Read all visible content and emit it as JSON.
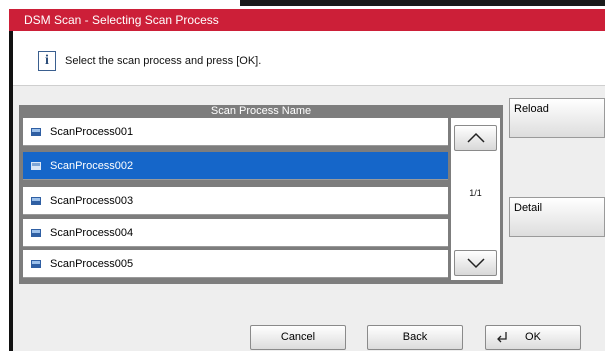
{
  "window": {
    "title": "DSM Scan - Selecting Scan Process"
  },
  "message": {
    "icon": "info-icon",
    "text": "Select the scan process and press [OK]."
  },
  "list": {
    "header": "Scan Process Name",
    "rows": [
      {
        "label": "ScanProcess001",
        "selected": false
      },
      {
        "label": "ScanProcess002",
        "selected": true
      },
      {
        "label": "ScanProcess003",
        "selected": false
      },
      {
        "label": "ScanProcess004",
        "selected": false
      },
      {
        "label": "ScanProcess005",
        "selected": false
      }
    ],
    "page_indicator": "1/1"
  },
  "side_buttons": {
    "reload": "Reload",
    "detail": "Detail"
  },
  "bottom_buttons": {
    "cancel": "Cancel",
    "back": "Back",
    "ok": "OK"
  },
  "colors": {
    "title_bar": "#cc1f38",
    "selection": "#1566c9",
    "list_panel": "#7d7d7d"
  }
}
